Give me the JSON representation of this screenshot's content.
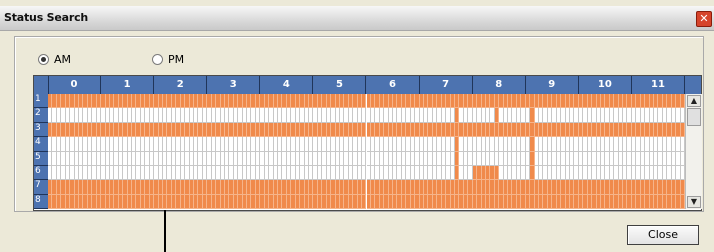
{
  "window": {
    "title": "Status Search",
    "close_glyph": "✕"
  },
  "period": {
    "options": [
      {
        "label": "AM",
        "selected": true
      },
      {
        "label": "PM",
        "selected": false
      }
    ]
  },
  "schedule": {
    "hours": [
      "0",
      "1",
      "2",
      "3",
      "4",
      "5",
      "6",
      "7",
      "8",
      "9",
      "10",
      "11"
    ],
    "slots_per_hour": 12,
    "channels": [
      "1",
      "2",
      "3",
      "4",
      "5",
      "6",
      "7",
      "8"
    ],
    "colors": {
      "recorded": "#f08a4b",
      "empty": "#ffffff",
      "header": "#4d73b0"
    },
    "recorded_ranges": [
      [
        [
          0,
          143
        ]
      ],
      [
        [
          92,
          92
        ],
        [
          101,
          101
        ],
        [
          109,
          109
        ]
      ],
      [
        [
          0,
          143
        ]
      ],
      [
        [
          92,
          92
        ],
        [
          109,
          109
        ]
      ],
      [
        [
          92,
          92
        ],
        [
          109,
          109
        ]
      ],
      [
        [
          92,
          92
        ],
        [
          96,
          101
        ],
        [
          109,
          109
        ]
      ],
      [
        [
          0,
          143
        ]
      ],
      [
        [
          0,
          143
        ]
      ]
    ]
  },
  "scrollbar": {
    "up_glyph": "▲",
    "down_glyph": "▼"
  },
  "buttons": {
    "close_label": "Close"
  }
}
